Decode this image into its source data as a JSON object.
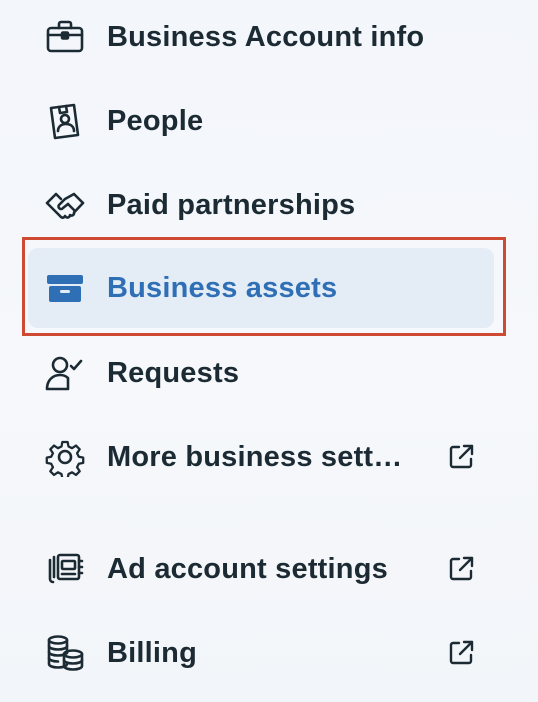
{
  "menu": {
    "items": [
      {
        "label": "Business Account info",
        "icon": "briefcase-icon",
        "external": false,
        "selected": false
      },
      {
        "label": "People",
        "icon": "id-badge-icon",
        "external": false,
        "selected": false
      },
      {
        "label": "Paid partnerships",
        "icon": "handshake-icon",
        "external": false,
        "selected": false
      },
      {
        "label": "Business assets",
        "icon": "archive-box-icon",
        "external": false,
        "selected": true
      },
      {
        "label": "Requests",
        "icon": "person-check-icon",
        "external": false,
        "selected": false
      },
      {
        "label": "More business sett…",
        "icon": "gear-icon",
        "external": true,
        "selected": false
      },
      {
        "label": "Ad account settings",
        "icon": "ad-account-icon",
        "external": true,
        "selected": false
      },
      {
        "label": "Billing",
        "icon": "coins-stack-icon",
        "external": true,
        "selected": false
      }
    ]
  },
  "colors": {
    "text": "#1c2b33",
    "selected_text": "#2f6fb6",
    "selected_background": "#e4ecf6",
    "highlight_border": "#cf4a32",
    "icon_blue": "#2f6fb6"
  }
}
